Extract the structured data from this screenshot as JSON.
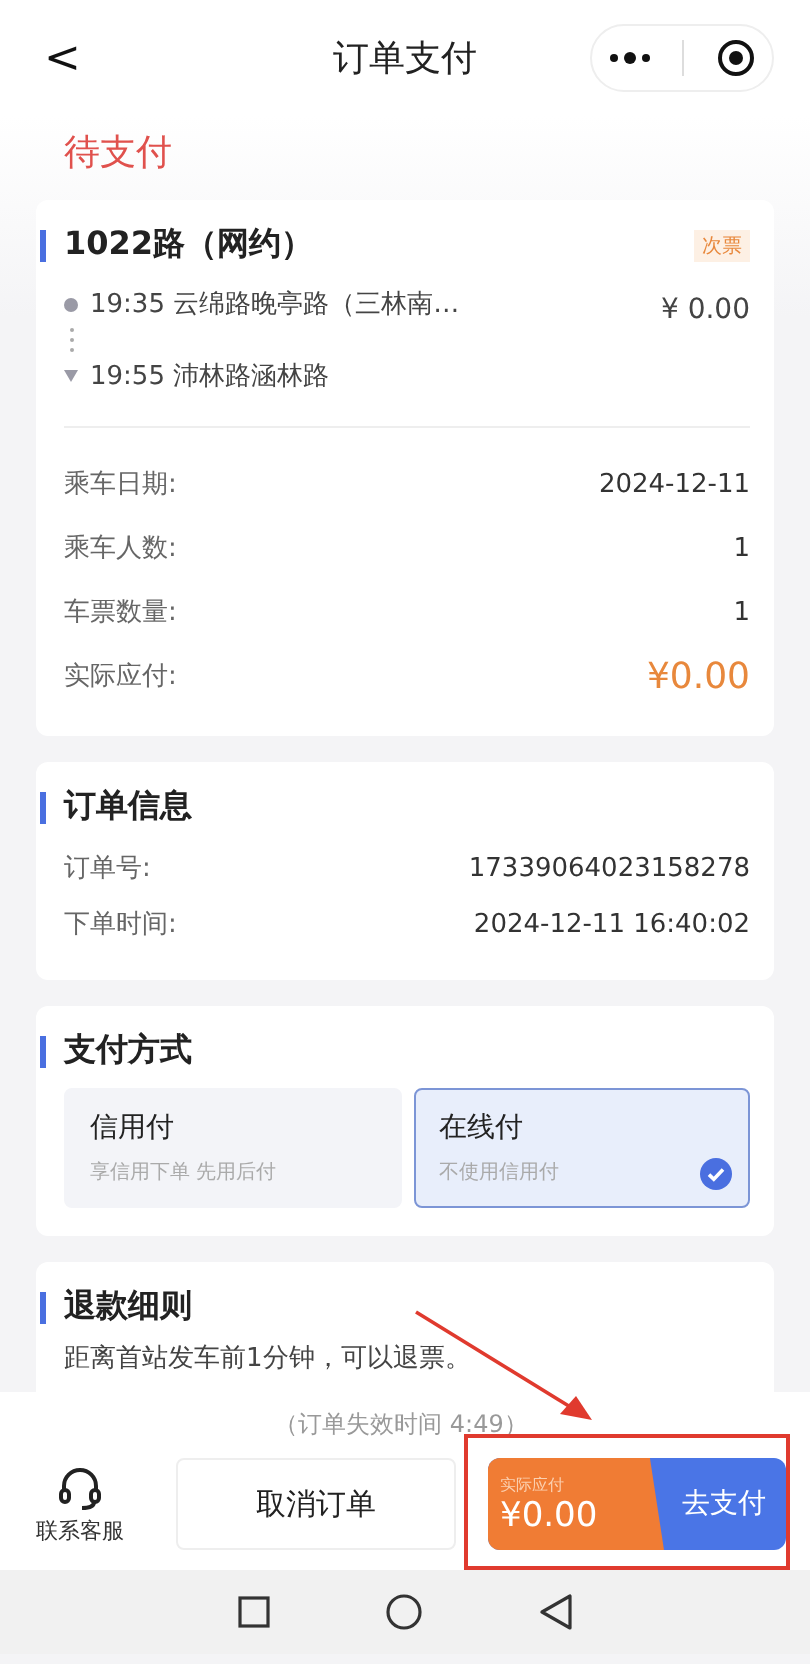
{
  "nav": {
    "back": "<",
    "title": "订单支付"
  },
  "status": "待支付",
  "trip": {
    "route": "1022路（网约）",
    "badge": "次票",
    "stops": [
      {
        "kind": "start",
        "text": "19:35 云绵路晚亭路（三林南…"
      },
      {
        "kind": "end",
        "text": "19:55 沛林路涵林路"
      }
    ],
    "price": "¥ 0.00",
    "rows": [
      {
        "label": "乘车日期:",
        "value": "2024-12-11",
        "kind": "plain"
      },
      {
        "label": "乘车人数:",
        "value": "1",
        "kind": "plain"
      },
      {
        "label": "车票数量:",
        "value": "1",
        "kind": "plain"
      },
      {
        "label": "实际应付:",
        "value": "¥0.00",
        "kind": "amount"
      }
    ]
  },
  "order": {
    "title": "订单信息",
    "rows": [
      {
        "label": "订单号:",
        "value": "17339064023158278"
      },
      {
        "label": "下单时间:",
        "value": "2024-12-11 16:40:02"
      }
    ]
  },
  "payment": {
    "title": "支付方式",
    "options": [
      {
        "name": "信用付",
        "hint": "享信用下单 先用后付",
        "selected": false
      },
      {
        "name": "在线付",
        "hint": "不使用信用付",
        "selected": true
      }
    ]
  },
  "refund": {
    "title": "退款细则",
    "text": "距离首站发车前1分钟，可以退票。"
  },
  "expiry": "（订单失效时间 4:49）",
  "support": "联系客服",
  "cancel": "取消订单",
  "pay": {
    "label": "实际应付",
    "amount": "¥0.00",
    "action": "去支付"
  }
}
